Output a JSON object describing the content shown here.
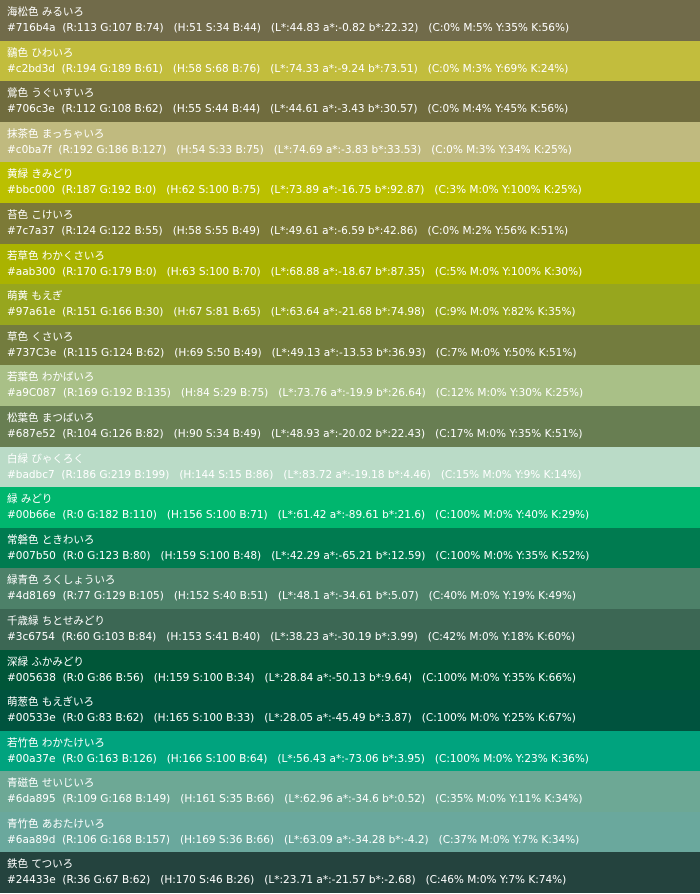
{
  "colors": [
    {
      "hex_color": "#716b4a",
      "name": "海松色 みるいろ",
      "code": "#716b4a",
      "rgb": "(R:113 G:107 B:74)",
      "hsb": "(H:51 S:34 B:44)",
      "lab": "(L*:44.83 a*:-0.82 b*:22.32)",
      "cmyk": "(C:0% M:5% Y:35% K:56%)"
    },
    {
      "hex_color": "#c2bd3d",
      "name": "鶸色 ひわいろ",
      "code": "#c2bd3d",
      "rgb": "(R:194 G:189 B:61)",
      "hsb": "(H:58 S:68 B:76)",
      "lab": "(L*:74.33 a*:-9.24 b*:73.51)",
      "cmyk": "(C:0% M:3% Y:69% K:24%)"
    },
    {
      "hex_color": "#706c3e",
      "name": "鶯色 うぐいすいろ",
      "code": "#706c3e",
      "rgb": "(R:112 G:108 B:62)",
      "hsb": "(H:55 S:44 B:44)",
      "lab": "(L*:44.61 a*:-3.43 b*:30.57)",
      "cmyk": "(C:0% M:4% Y:45% K:56%)"
    },
    {
      "hex_color": "#c0ba7f",
      "name": "抹茶色 まっちゃいろ",
      "code": "#c0ba7f",
      "rgb": "(R:192 G:186 B:127)",
      "hsb": "(H:54 S:33 B:75)",
      "lab": "(L*:74.69 a*:-3.83 b*:33.53)",
      "cmyk": "(C:0% M:3% Y:34% K:25%)"
    },
    {
      "hex_color": "#bbc000",
      "name": "黄緑 きみどり",
      "code": "#bbc000",
      "rgb": "(R:187 G:192 B:0)",
      "hsb": "(H:62 S:100 B:75)",
      "lab": "(L*:73.89 a*:-16.75 b*:92.87)",
      "cmyk": "(C:3% M:0% Y:100% K:25%)"
    },
    {
      "hex_color": "#7c7a37",
      "name": "苔色 こけいろ",
      "code": "#7c7a37",
      "rgb": "(R:124 G:122 B:55)",
      "hsb": "(H:58 S:55 B:49)",
      "lab": "(L*:49.61 a*:-6.59 b*:42.86)",
      "cmyk": "(C:0% M:2% Y:56% K:51%)"
    },
    {
      "hex_color": "#aab300",
      "name": "若草色 わかくさいろ",
      "code": "#aab300",
      "rgb": "(R:170 G:179 B:0)",
      "hsb": "(H:63 S:100 B:70)",
      "lab": "(L*:68.88 a*:-18.67 b*:87.35)",
      "cmyk": "(C:5% M:0% Y:100% K:30%)"
    },
    {
      "hex_color": "#97a61e",
      "name": "萌黄 もえぎ",
      "code": "#97a61e",
      "rgb": "(R:151 G:166 B:30)",
      "hsb": "(H:67 S:81 B:65)",
      "lab": "(L*:63.64 a*:-21.68 b*:74.98)",
      "cmyk": "(C:9% M:0% Y:82% K:35%)"
    },
    {
      "hex_color": "#737c3e",
      "name": "草色 くさいろ",
      "code": "#737C3e",
      "rgb": "(R:115 G:124 B:62)",
      "hsb": "(H:69 S:50 B:49)",
      "lab": "(L*:49.13 a*:-13.53 b*:36.93)",
      "cmyk": "(C:7% M:0% Y:50% K:51%)"
    },
    {
      "hex_color": "#a9c087",
      "name": "若葉色 わかばいろ",
      "code": "#a9C087",
      "rgb": "(R:169 G:192 B:135)",
      "hsb": "(H:84 S:29 B:75)",
      "lab": "(L*:73.76 a*:-19.9 b*:26.64)",
      "cmyk": "(C:12% M:0% Y:30% K:25%)"
    },
    {
      "hex_color": "#687e52",
      "name": "松葉色 まつばいろ",
      "code": "#687e52",
      "rgb": "(R:104 G:126 B:82)",
      "hsb": "(H:90 S:34 B:49)",
      "lab": "(L*:48.93 a*:-20.02 b*:22.43)",
      "cmyk": "(C:17% M:0% Y:35% K:51%)"
    },
    {
      "hex_color": "#badbc7",
      "name": "白緑 びゃくろく",
      "code": "#badbc7",
      "rgb": "(R:186 G:219 B:199)",
      "hsb": "(H:144 S:15 B:86)",
      "lab": "(L*:83.72 a*:-19.18 b*:4.46)",
      "cmyk": "(C:15% M:0% Y:9% K:14%)"
    },
    {
      "hex_color": "#00b66e",
      "name": "緑 みどり",
      "code": "#00b66e",
      "rgb": "(R:0 G:182 B:110)",
      "hsb": "(H:156 S:100 B:71)",
      "lab": "(L*:61.42 a*:-89.61 b*:21.6)",
      "cmyk": "(C:100% M:0% Y:40% K:29%)"
    },
    {
      "hex_color": "#007b50",
      "name": "常磐色 ときわいろ",
      "code": "#007b50",
      "rgb": "(R:0 G:123 B:80)",
      "hsb": "(H:159 S:100 B:48)",
      "lab": "(L*:42.29 a*:-65.21 b*:12.59)",
      "cmyk": "(C:100% M:0% Y:35% K:52%)"
    },
    {
      "hex_color": "#4d8169",
      "name": "緑青色 ろくしょういろ",
      "code": "#4d8169",
      "rgb": "(R:77 G:129 B:105)",
      "hsb": "(H:152 S:40 B:51)",
      "lab": "(L*:48.1 a*:-34.61 b*:5.07)",
      "cmyk": "(C:40% M:0% Y:19% K:49%)"
    },
    {
      "hex_color": "#3c6754",
      "name": "千歳緑 ちとせみどり",
      "code": "#3c6754",
      "rgb": "(R:60 G:103 B:84)",
      "hsb": "(H:153 S:41 B:40)",
      "lab": "(L*:38.23 a*:-30.19 b*:3.99)",
      "cmyk": "(C:42% M:0% Y:18% K:60%)"
    },
    {
      "hex_color": "#005638",
      "name": "深緑 ふかみどり",
      "code": "#005638",
      "rgb": "(R:0 G:86 B:56)",
      "hsb": "(H:159 S:100 B:34)",
      "lab": "(L*:28.84 a*:-50.13 b*:9.64)",
      "cmyk": "(C:100% M:0% Y:35% K:66%)"
    },
    {
      "hex_color": "#00533e",
      "name": "萌葱色 もえぎいろ",
      "code": "#00533e",
      "rgb": "(R:0 G:83 B:62)",
      "hsb": "(H:165 S:100 B:33)",
      "lab": "(L*:28.05 a*:-45.49 b*:3.87)",
      "cmyk": "(C:100% M:0% Y:25% K:67%)"
    },
    {
      "hex_color": "#00a37e",
      "name": "若竹色 わかたけいろ",
      "code": "#00a37e",
      "rgb": "(R:0 G:163 B:126)",
      "hsb": "(H:166 S:100 B:64)",
      "lab": "(L*:56.43 a*:-73.06 b*:3.95)",
      "cmyk": "(C:100% M:0% Y:23% K:36%)"
    },
    {
      "hex_color": "#6da895",
      "name": "青磁色 せいじいろ",
      "code": "#6da895",
      "rgb": "(R:109 G:168 B:149)",
      "hsb": "(H:161 S:35 B:66)",
      "lab": "(L*:62.96 a*:-34.6 b*:0.52)",
      "cmyk": "(C:35% M:0% Y:11% K:34%)"
    },
    {
      "hex_color": "#6aa89d",
      "name": "青竹色 あおたけいろ",
      "code": "#6aa89d",
      "rgb": "(R:106 G:168 B:157)",
      "hsb": "(H:169 S:36 B:66)",
      "lab": "(L*:63.09 a*:-34.28 b*:-4.2)",
      "cmyk": "(C:37% M:0% Y:7% K:34%)"
    },
    {
      "hex_color": "#24433e",
      "name": "鉄色 てついろ",
      "code": "#24433e",
      "rgb": "(R:36 G:67 B:62)",
      "hsb": "(H:170 S:46 B:26)",
      "lab": "(L*:23.71 a*:-21.57 b*:-2.68)",
      "cmyk": "(C:46% M:0% Y:7% K:74%)"
    }
  ]
}
